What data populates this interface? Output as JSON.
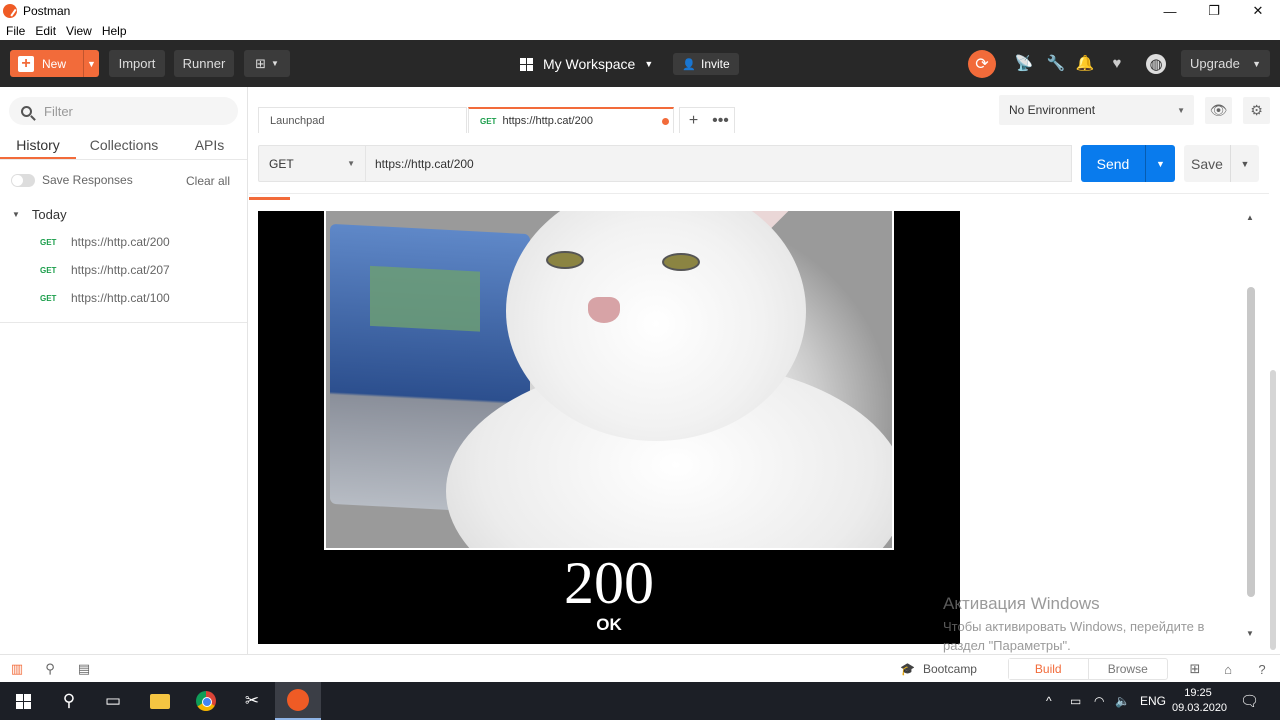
{
  "window": {
    "title": "Postman",
    "controls": [
      "—",
      "❐",
      "✕"
    ]
  },
  "menu": [
    "File",
    "Edit",
    "View",
    "Help"
  ],
  "header": {
    "new_label": "New",
    "import_label": "Import",
    "runner_label": "Runner",
    "workspace_label": "My Workspace",
    "invite_label": "Invite",
    "upgrade_label": "Upgrade",
    "accent_color": "#f26b3a"
  },
  "sidebar": {
    "filter_placeholder": "Filter",
    "tabs": [
      "History",
      "Collections",
      "APIs"
    ],
    "save_responses_label": "Save Responses",
    "clear_all_label": "Clear all",
    "group_label": "Today",
    "history": [
      {
        "method": "GET",
        "url": "https://http.cat/200"
      },
      {
        "method": "GET",
        "url": "https://http.cat/207"
      },
      {
        "method": "GET",
        "url": "https://http.cat/100"
      }
    ]
  },
  "request_tabs": [
    {
      "label": "Launchpad"
    },
    {
      "method": "GET",
      "label": "https://http.cat/200"
    }
  ],
  "environment": {
    "selected": "No Environment"
  },
  "request": {
    "method": "GET",
    "url": "https://http.cat/200",
    "send_label": "Send",
    "save_label": "Save"
  },
  "response": {
    "code": "200",
    "status_text": "OK"
  },
  "activation": {
    "title": "Активация Windows",
    "message": "Чтобы активировать Windows, перейдите в раздел \"Параметры\"."
  },
  "footer": {
    "bootcamp_label": "Bootcamp",
    "build_label": "Build",
    "browse_label": "Browse"
  },
  "taskbar": {
    "language": "ENG",
    "time": "19:25",
    "date": "09.03.2020"
  }
}
